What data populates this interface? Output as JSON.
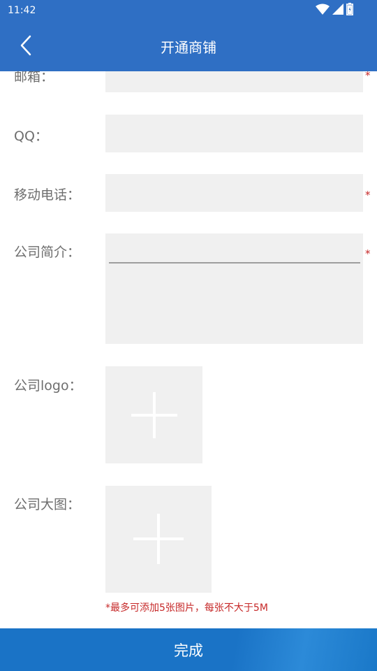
{
  "status_bar": {
    "time": "11:42",
    "icons": [
      "wifi-icon",
      "signal-icon",
      "battery-icon"
    ]
  },
  "header": {
    "title": "开通商铺",
    "back_icon": "chevron-left-icon"
  },
  "form": {
    "email_label": "邮箱：",
    "qq_label": "QQ：",
    "mobile_label": "移动电话：",
    "intro_label": "公司简介：",
    "logo_label": "公司logo：",
    "banner_label": "公司大图：",
    "required_mark": "*",
    "upload_hint": "*最多可添加5张图片，每张不大于5M"
  },
  "footer": {
    "submit_label": "完成"
  },
  "colors": {
    "primary": "#2f6fc4",
    "button": "#1a73c6",
    "field_bg": "#f0f0f0",
    "required": "#c62828",
    "label": "#6e6e6e"
  }
}
